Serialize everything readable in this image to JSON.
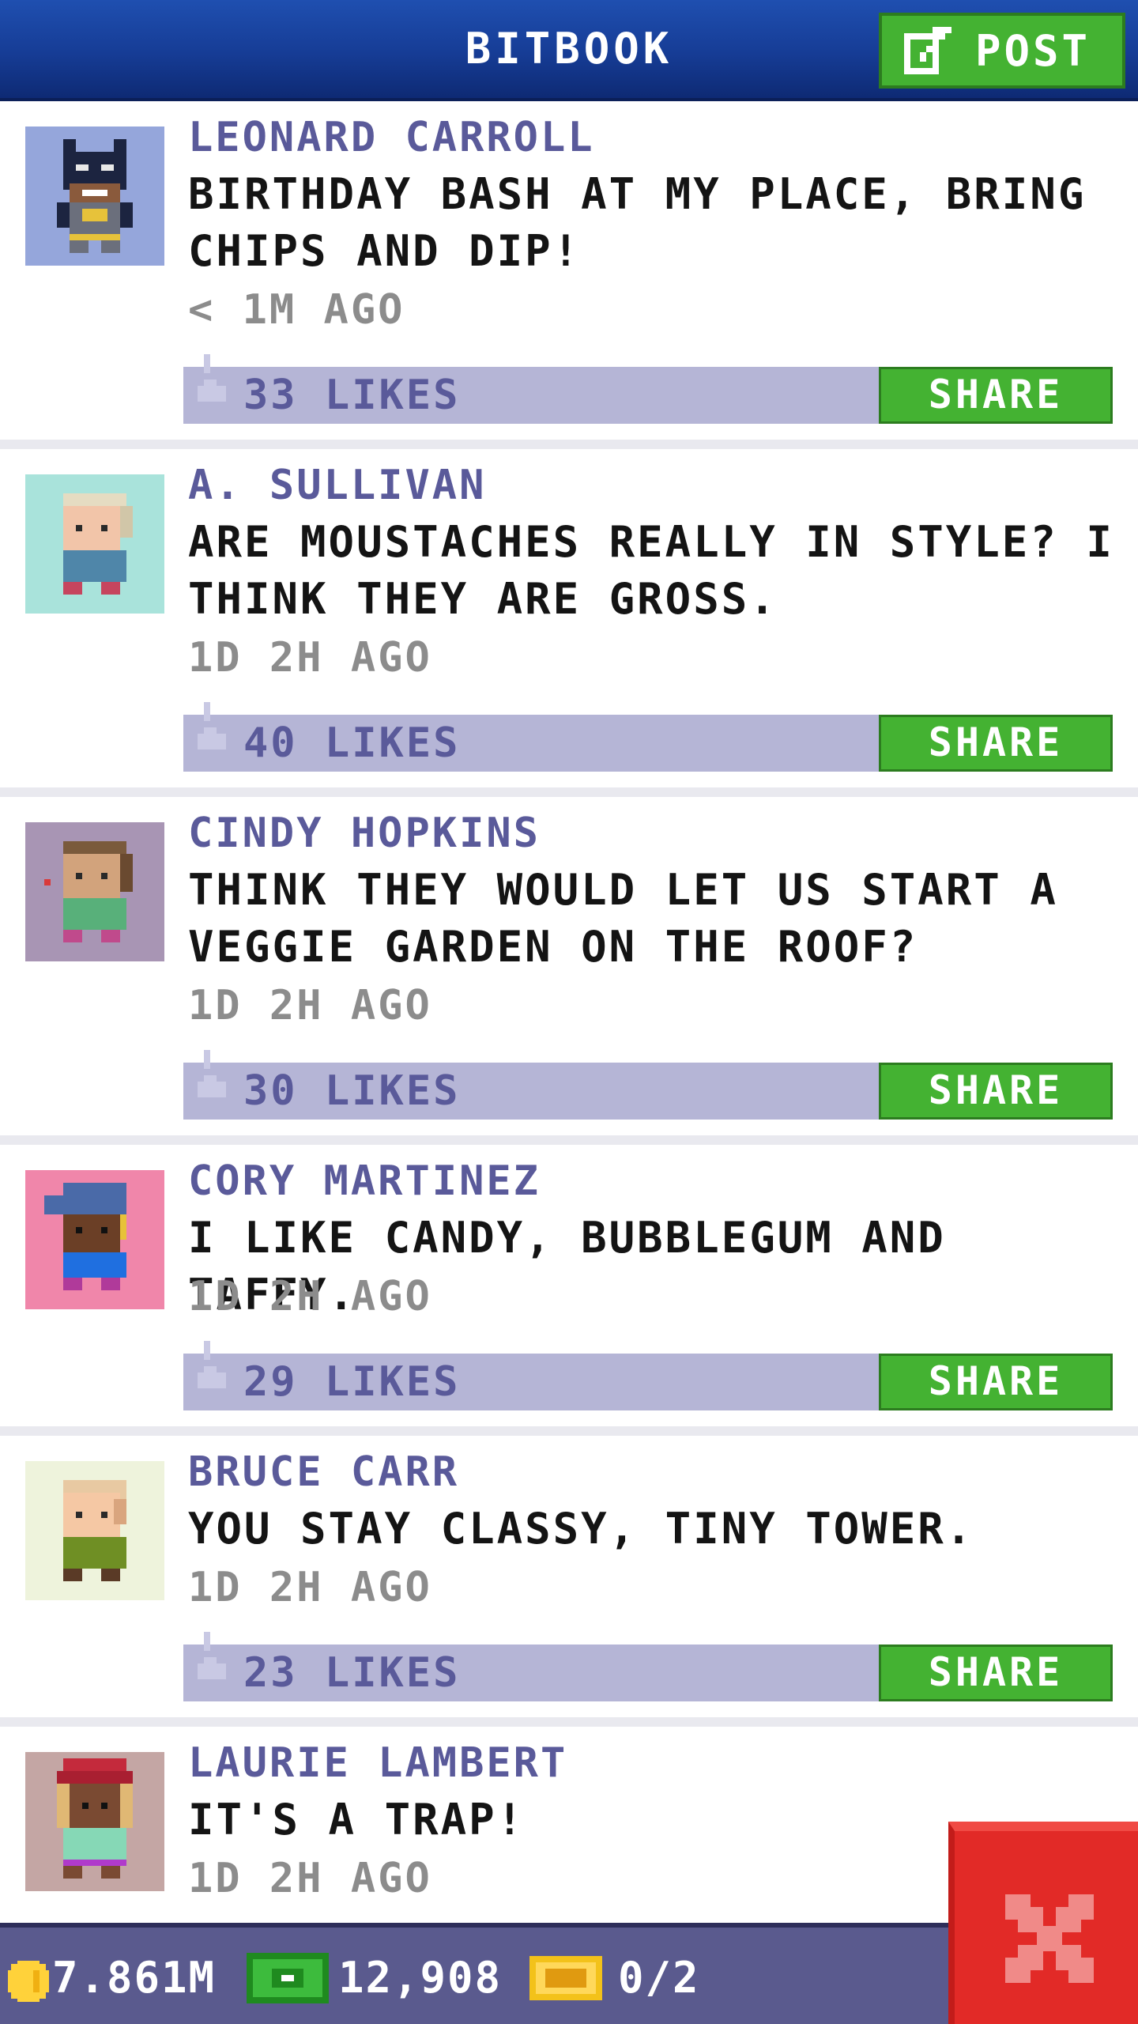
{
  "header": {
    "title": "BITBOOK",
    "post_label": "POST"
  },
  "posts": [
    {
      "author": "LEONARD CARROLL",
      "message": "BIRTHDAY BASH AT MY PLACE, BRING CHIPS AND DIP!",
      "time": "< 1M AGO",
      "likes": "33 LIKES",
      "share_label": "SHARE",
      "avatar_bg": "#95a6db"
    },
    {
      "author": "A. SULLIVAN",
      "message": "ARE MOUSTACHES REALLY IN STYLE? I THINK THEY ARE GROSS.",
      "time": "1D 2H AGO",
      "likes": "40 LIKES",
      "share_label": "SHARE",
      "avatar_bg": "#a9e3db"
    },
    {
      "author": "CINDY HOPKINS",
      "message": "THINK THEY WOULD LET US START A VEGGIE GARDEN ON THE ROOF?",
      "time": "1D 2H AGO",
      "likes": "30 LIKES",
      "share_label": "SHARE",
      "avatar_bg": "#a895b4"
    },
    {
      "author": "CORY MARTINEZ",
      "message": "I LIKE CANDY, BUBBLEGUM AND TAFFY.",
      "time": "1D 2H AGO",
      "likes": "29 LIKES",
      "share_label": "SHARE",
      "avatar_bg": "#f086aa"
    },
    {
      "author": "BRUCE CARR",
      "message": "YOU STAY CLASSY, TINY TOWER.",
      "time": "1D 2H AGO",
      "likes": "23 LIKES",
      "share_label": "SHARE",
      "avatar_bg": "#eef3dc"
    },
    {
      "author": "LAURIE LAMBERT",
      "message": "IT'S A TRAP!",
      "time": "1D 2H AGO",
      "likes": "",
      "share_label": "",
      "avatar_bg": "#c4a6a4"
    }
  ],
  "status_bar": {
    "coins": "7.861M",
    "bux": "12,908",
    "tickets": "0/2"
  },
  "colors": {
    "header_blue": "#163c95",
    "button_green": "#44b232",
    "like_bar": "#b5b5d6",
    "close_red": "#e22a27"
  }
}
